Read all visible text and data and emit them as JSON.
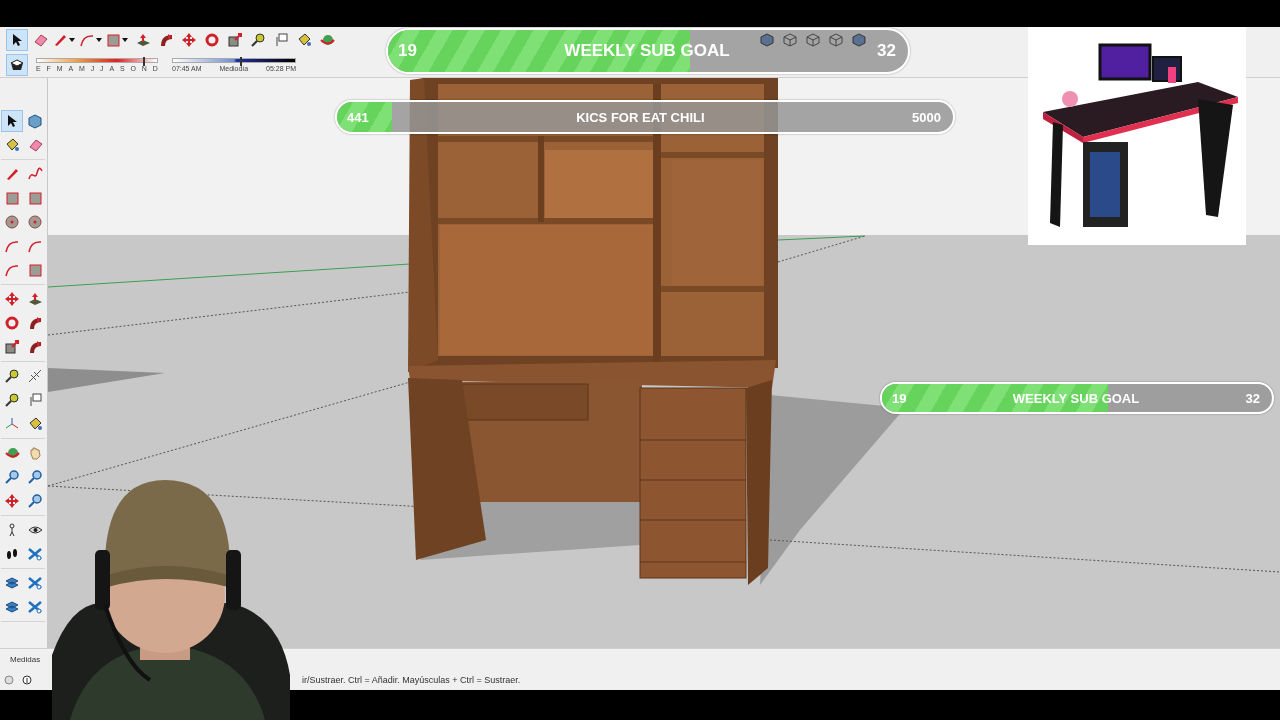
{
  "toolbar": {
    "tools": [
      {
        "kind": "select",
        "selected": true,
        "dropdown": false
      },
      {
        "kind": "eraser",
        "selected": false,
        "dropdown": false
      },
      {
        "kind": "pencil",
        "selected": false,
        "dropdown": true
      },
      {
        "kind": "arc",
        "selected": false,
        "dropdown": true
      },
      {
        "kind": "rect",
        "selected": false,
        "dropdown": true
      },
      {
        "kind": "pushpull",
        "selected": false,
        "dropdown": false
      },
      {
        "kind": "followme",
        "selected": false,
        "dropdown": false
      },
      {
        "kind": "move",
        "selected": false,
        "dropdown": false
      },
      {
        "kind": "rotate",
        "selected": false,
        "dropdown": false
      },
      {
        "kind": "scale",
        "selected": false,
        "dropdown": false
      },
      {
        "kind": "tape",
        "selected": false,
        "dropdown": false
      },
      {
        "kind": "text",
        "selected": false,
        "dropdown": false
      },
      {
        "kind": "paint",
        "selected": false,
        "dropdown": false
      },
      {
        "kind": "orbit",
        "selected": false,
        "dropdown": false
      }
    ],
    "right_tools": [
      {
        "kind": "cube",
        "selected": false,
        "dropdown": false
      },
      {
        "kind": "wirecube",
        "selected": false,
        "dropdown": false
      },
      {
        "kind": "wirecube",
        "selected": false,
        "dropdown": false
      },
      {
        "kind": "wirecube",
        "selected": false,
        "dropdown": false
      },
      {
        "kind": "cube",
        "selected": false,
        "dropdown": false
      }
    ]
  },
  "shadow_timeline": {
    "months": [
      "E",
      "F",
      "M",
      "A",
      "M",
      "J",
      "J",
      "A",
      "S",
      "O",
      "N",
      "D"
    ],
    "times": [
      "07:45 AM",
      "Mediodía",
      "05:28 PM"
    ],
    "date_slider": {
      "level": 0.88
    },
    "time_slider": {
      "level": 0.55
    }
  },
  "left_toolbar": {
    "groups": [
      [
        {
          "kind": "select",
          "selected": true
        },
        {
          "kind": "component",
          "selected": false
        },
        {
          "kind": "paint",
          "selected": false
        },
        {
          "kind": "eraser",
          "selected": false
        }
      ],
      [
        {
          "kind": "pencil",
          "selected": false
        },
        {
          "kind": "freehand",
          "selected": false
        },
        {
          "kind": "rect",
          "selected": false
        },
        {
          "kind": "rect",
          "selected": false
        },
        {
          "kind": "circle",
          "selected": false
        },
        {
          "kind": "circle",
          "selected": false
        },
        {
          "kind": "arc",
          "selected": false
        },
        {
          "kind": "arc",
          "selected": false
        },
        {
          "kind": "arc",
          "selected": false
        },
        {
          "kind": "rect",
          "selected": false
        }
      ],
      [
        {
          "kind": "move",
          "selected": false
        },
        {
          "kind": "pushpull",
          "selected": false
        },
        {
          "kind": "rotate",
          "selected": false
        },
        {
          "kind": "followme",
          "selected": false
        },
        {
          "kind": "scale",
          "selected": false
        },
        {
          "kind": "followme",
          "selected": false
        }
      ],
      [
        {
          "kind": "tape",
          "selected": false
        },
        {
          "kind": "dimension",
          "selected": false
        },
        {
          "kind": "tape",
          "selected": false
        },
        {
          "kind": "text",
          "selected": false
        },
        {
          "kind": "axes",
          "selected": false
        },
        {
          "kind": "paint",
          "selected": false
        }
      ],
      [
        {
          "kind": "orbit",
          "selected": false
        },
        {
          "kind": "hand",
          "selected": false
        },
        {
          "kind": "zoom",
          "selected": false
        },
        {
          "kind": "zoom",
          "selected": false
        },
        {
          "kind": "move",
          "selected": false
        },
        {
          "kind": "zoom",
          "selected": false
        }
      ],
      [
        {
          "kind": "figure",
          "selected": false
        },
        {
          "kind": "eye",
          "selected": false
        },
        {
          "kind": "walk",
          "selected": false
        },
        {
          "kind": "section",
          "selected": false
        }
      ],
      [
        {
          "kind": "layers",
          "selected": false
        },
        {
          "kind": "section",
          "selected": false
        },
        {
          "kind": "layers",
          "selected": false
        },
        {
          "kind": "section",
          "selected": false
        }
      ]
    ]
  },
  "measurements": {
    "label": "Medidas"
  },
  "status_bar": {
    "hint": "ir/Sustraer. Ctrl = Añadir. Mayúsculas + Ctrl = Sustraer."
  },
  "overlays": {
    "sub_goal_top": {
      "current": "19",
      "label": "WEEKLY SUB GOAL",
      "target": "32",
      "level": 0.58
    },
    "kics_goal": {
      "current": "441",
      "label": "KICS FOR EAT CHILI",
      "target": "5000",
      "level": 0.09
    },
    "sub_goal_side": {
      "current": "19",
      "label": "WEEKLY SUB GOAL",
      "target": "32",
      "level": 0.58
    }
  }
}
